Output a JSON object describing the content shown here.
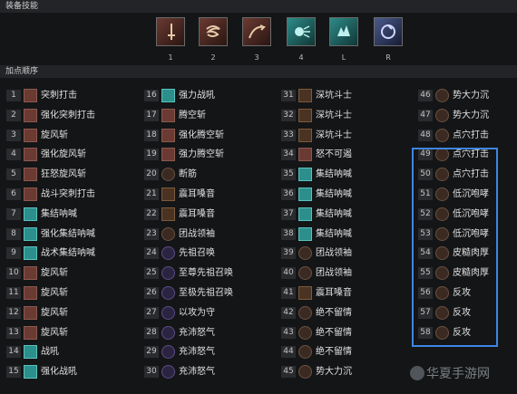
{
  "header_equipment": "装备技能",
  "header_order": "加点顺序",
  "skill_slots": [
    {
      "key": "1",
      "color": "red",
      "icon": "sword-icon"
    },
    {
      "key": "2",
      "color": "red",
      "icon": "whirlwind-icon"
    },
    {
      "key": "3",
      "color": "red",
      "icon": "leap-icon"
    },
    {
      "key": "4",
      "color": "teal",
      "icon": "shout-icon"
    },
    {
      "key": "L",
      "color": "teal",
      "icon": "roar-icon"
    },
    {
      "key": "R",
      "color": "ice",
      "icon": "spin-icon"
    }
  ],
  "order": [
    {
      "n": "1",
      "name": "突刺打击",
      "ic": "red"
    },
    {
      "n": "2",
      "name": "强化突刺打击",
      "ic": "red"
    },
    {
      "n": "3",
      "name": "旋风斩",
      "ic": "red"
    },
    {
      "n": "4",
      "name": "强化旋风斩",
      "ic": "red"
    },
    {
      "n": "5",
      "name": "狂怒旋风斩",
      "ic": "red"
    },
    {
      "n": "6",
      "name": "战斗突刺打击",
      "ic": "red"
    },
    {
      "n": "7",
      "name": "集结呐喊",
      "ic": "teal"
    },
    {
      "n": "8",
      "name": "强化集结呐喊",
      "ic": "teal"
    },
    {
      "n": "9",
      "name": "战术集结呐喊",
      "ic": "teal"
    },
    {
      "n": "10",
      "name": "旋风斩",
      "ic": "red"
    },
    {
      "n": "11",
      "name": "旋风斩",
      "ic": "red"
    },
    {
      "n": "12",
      "name": "旋风斩",
      "ic": "red"
    },
    {
      "n": "13",
      "name": "旋风斩",
      "ic": "red"
    },
    {
      "n": "14",
      "name": "战吼",
      "ic": "teal"
    },
    {
      "n": "15",
      "name": "强化战吼",
      "ic": "teal"
    },
    {
      "n": "16",
      "name": "强力战吼",
      "ic": "teal"
    },
    {
      "n": "17",
      "name": "腾空斩",
      "ic": "red"
    },
    {
      "n": "18",
      "name": "强化腾空斩",
      "ic": "red"
    },
    {
      "n": "19",
      "name": "强力腾空斩",
      "ic": "red"
    },
    {
      "n": "20",
      "name": "断筋",
      "ic": "dark"
    },
    {
      "n": "21",
      "name": "震耳嗓音",
      "ic": "brown"
    },
    {
      "n": "22",
      "name": "震耳嗓音",
      "ic": "brown"
    },
    {
      "n": "23",
      "name": "团战领袖",
      "ic": "dark"
    },
    {
      "n": "24",
      "name": "先祖召唤",
      "ic": "purple"
    },
    {
      "n": "25",
      "name": "至尊先祖召唤",
      "ic": "purple"
    },
    {
      "n": "26",
      "name": "至极先祖召唤",
      "ic": "purple"
    },
    {
      "n": "27",
      "name": "以攻为守",
      "ic": "purple"
    },
    {
      "n": "28",
      "name": "充沛怒气",
      "ic": "purple"
    },
    {
      "n": "29",
      "name": "充沛怒气",
      "ic": "purple"
    },
    {
      "n": "30",
      "name": "充沛怒气",
      "ic": "purple"
    },
    {
      "n": "31",
      "name": "深坑斗士",
      "ic": "brown"
    },
    {
      "n": "32",
      "name": "深坑斗士",
      "ic": "brown"
    },
    {
      "n": "33",
      "name": "深坑斗士",
      "ic": "brown"
    },
    {
      "n": "34",
      "name": "怒不可遏",
      "ic": "red"
    },
    {
      "n": "35",
      "name": "集结呐喊",
      "ic": "teal"
    },
    {
      "n": "36",
      "name": "集结呐喊",
      "ic": "teal"
    },
    {
      "n": "37",
      "name": "集结呐喊",
      "ic": "teal"
    },
    {
      "n": "38",
      "name": "集结呐喊",
      "ic": "teal"
    },
    {
      "n": "39",
      "name": "团战领袖",
      "ic": "dark"
    },
    {
      "n": "40",
      "name": "团战领袖",
      "ic": "dark"
    },
    {
      "n": "41",
      "name": "震耳嗓音",
      "ic": "brown"
    },
    {
      "n": "42",
      "name": "绝不留情",
      "ic": "dark"
    },
    {
      "n": "43",
      "name": "绝不留情",
      "ic": "dark"
    },
    {
      "n": "44",
      "name": "绝不留情",
      "ic": "dark"
    },
    {
      "n": "45",
      "name": "势大力沉",
      "ic": "dark"
    },
    {
      "n": "46",
      "name": "势大力沉",
      "ic": "dark"
    },
    {
      "n": "47",
      "name": "势大力沉",
      "ic": "dark"
    },
    {
      "n": "48",
      "name": "点穴打击",
      "ic": "dark"
    },
    {
      "n": "49",
      "name": "点穴打击",
      "ic": "dark"
    },
    {
      "n": "50",
      "name": "点穴打击",
      "ic": "dark"
    },
    {
      "n": "51",
      "name": "低沉咆哮",
      "ic": "dark"
    },
    {
      "n": "52",
      "name": "低沉咆哮",
      "ic": "dark"
    },
    {
      "n": "53",
      "name": "低沉咆哮",
      "ic": "dark"
    },
    {
      "n": "54",
      "name": "皮糙肉厚",
      "ic": "dark"
    },
    {
      "n": "55",
      "name": "皮糙肉厚",
      "ic": "dark"
    },
    {
      "n": "56",
      "name": "反攻",
      "ic": "dark"
    },
    {
      "n": "57",
      "name": "反攻",
      "ic": "dark"
    },
    {
      "n": "58",
      "name": "反攻",
      "ic": "dark"
    }
  ],
  "watermark": "华夏手游网"
}
